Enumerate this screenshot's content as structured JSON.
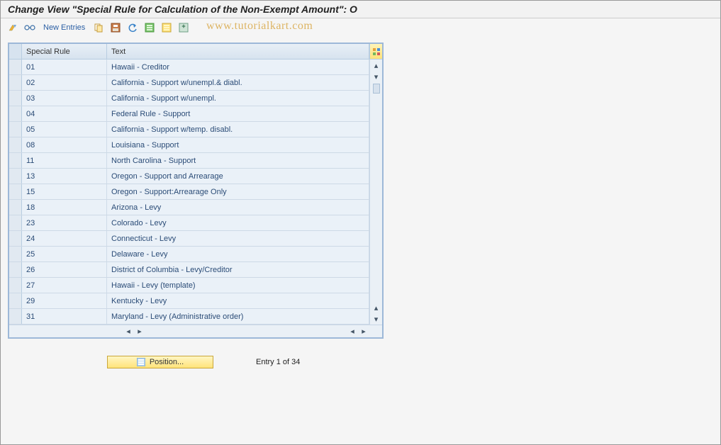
{
  "title": "Change View \"Special Rule for Calculation of the Non-Exempt Amount\": O",
  "toolbar": {
    "new_entries_label": "New Entries"
  },
  "watermark": "www.tutorialkart.com",
  "table": {
    "columns": {
      "a": "Special Rule",
      "b": "Text"
    },
    "rows": [
      {
        "code": "01",
        "text": "Hawaii - Creditor"
      },
      {
        "code": "02",
        "text": "California - Support w/unempl.& diabl."
      },
      {
        "code": "03",
        "text": "California - Support w/unempl."
      },
      {
        "code": "04",
        "text": "Federal Rule - Support"
      },
      {
        "code": "05",
        "text": "California - Support w/temp. disabl."
      },
      {
        "code": "08",
        "text": "Louisiana - Support"
      },
      {
        "code": "11",
        "text": "North Carolina - Support"
      },
      {
        "code": "13",
        "text": "Oregon - Support and Arrearage"
      },
      {
        "code": "15",
        "text": "Oregon - Support:Arrearage Only"
      },
      {
        "code": "18",
        "text": "Arizona - Levy"
      },
      {
        "code": "23",
        "text": "Colorado - Levy"
      },
      {
        "code": "24",
        "text": "Connecticut - Levy"
      },
      {
        "code": "25",
        "text": "Delaware - Levy"
      },
      {
        "code": "26",
        "text": "District of Columbia - Levy/Creditor"
      },
      {
        "code": "27",
        "text": "Hawaii - Levy (template)"
      },
      {
        "code": "29",
        "text": "Kentucky - Levy"
      },
      {
        "code": "31",
        "text": "Maryland - Levy (Administrative order)"
      }
    ]
  },
  "footer": {
    "position_label": "Position...",
    "entry_status": "Entry 1 of 34"
  }
}
